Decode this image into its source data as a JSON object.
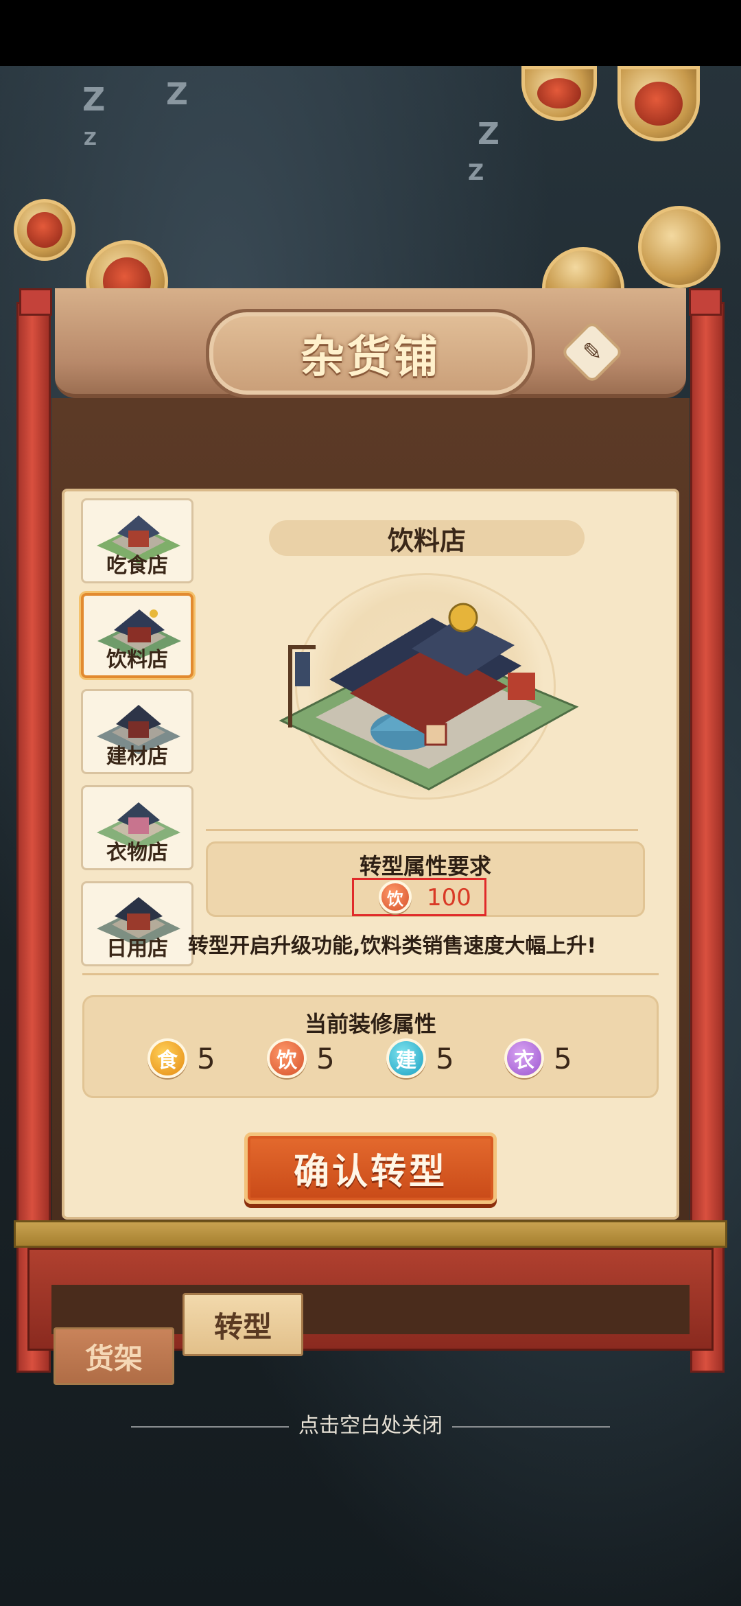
{
  "window": {
    "title": "杂货铺"
  },
  "shop_list": [
    {
      "label": "吃食店"
    },
    {
      "label": "饮料店"
    },
    {
      "label": "建材店"
    },
    {
      "label": "衣物店"
    },
    {
      "label": "日用店"
    }
  ],
  "selected_shop": {
    "name": "饮料店"
  },
  "requirement": {
    "title": "转型属性要求",
    "badge": "饮",
    "value": "100"
  },
  "description": "转型开启升级功能,饮料类销售速度大幅上升!",
  "current_attributes": {
    "title": "当前装修属性",
    "items": [
      {
        "badge": "食",
        "value": "5"
      },
      {
        "badge": "饮",
        "value": "5"
      },
      {
        "badge": "建",
        "value": "5"
      },
      {
        "badge": "衣",
        "value": "5"
      }
    ]
  },
  "confirm_button": "确认转型",
  "bottom_tabs": {
    "transform": "转型",
    "shelf": "货架"
  },
  "close_hint": "点击空白处关闭",
  "background_text": [
    "Z",
    "Z",
    "Z",
    "Z",
    "Z"
  ]
}
